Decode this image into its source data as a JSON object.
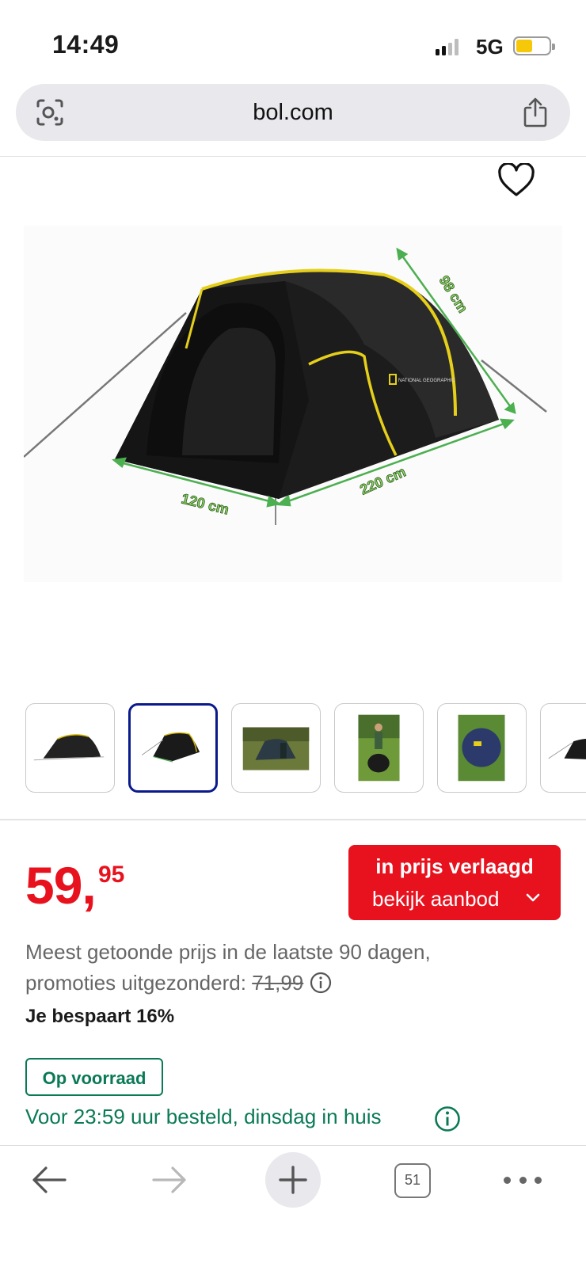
{
  "status_bar": {
    "time": "14:49",
    "network": "5G",
    "signal_bars_filled": 2,
    "signal_bars_total": 4
  },
  "browser": {
    "url": "bol.com",
    "tab_count": "51"
  },
  "product_image": {
    "dimension_labels": {
      "depth": "98 cm",
      "width": "120 cm",
      "length": "220 cm"
    },
    "brand_mark": "NATIONAL GEOGRAPHIC"
  },
  "gallery": {
    "selected_index": 1,
    "thumbnails": [
      "tent-side-view",
      "tent-front-view",
      "tent-in-field",
      "person-with-bag",
      "packed-tent-on-grass",
      "tent-partial"
    ]
  },
  "price": {
    "whole": "59,",
    "cents": "95",
    "deal_title": "in prijs verlaagd",
    "deal_subtitle": "bekijk aanbod",
    "note_line1": "Meest getoonde prijs in de laatste 90 dagen,",
    "note_line2": "promoties uitgezonderd:",
    "old_price": "71,99",
    "savings": "Je bespaart 16%"
  },
  "availability": {
    "stock_label": "Op voorraad",
    "delivery": "Voor 23:59 uur besteld, dinsdag in huis"
  },
  "colors": {
    "price_red": "#e8121e",
    "stock_green": "#0a7a56",
    "selected_thumb_border": "#0a1a8c",
    "measure_green": "#4caf50"
  }
}
